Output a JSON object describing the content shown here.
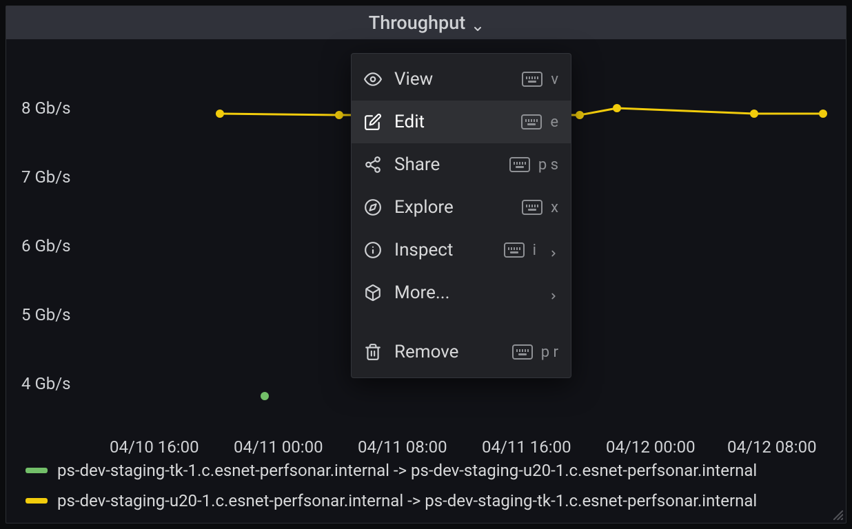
{
  "panel": {
    "title": "Throughput"
  },
  "menu": {
    "items": [
      {
        "label": "View",
        "shortcut": "v",
        "icon": "eye-icon",
        "has_sub": false
      },
      {
        "label": "Edit",
        "shortcut": "e",
        "icon": "edit-icon",
        "has_sub": false,
        "highlighted": true
      },
      {
        "label": "Share",
        "shortcut": "p s",
        "icon": "share-icon",
        "has_sub": false
      },
      {
        "label": "Explore",
        "shortcut": "x",
        "icon": "compass-icon",
        "has_sub": false
      },
      {
        "label": "Inspect",
        "shortcut": "i",
        "icon": "info-icon",
        "has_sub": true
      },
      {
        "label": "More...",
        "shortcut": "",
        "icon": "cube-icon",
        "has_sub": true
      }
    ],
    "remove": {
      "label": "Remove",
      "shortcut": "p r",
      "icon": "trash-icon"
    }
  },
  "legend": [
    {
      "color": "green",
      "label": "ps-dev-staging-tk-1.c.esnet-perfsonar.internal -> ps-dev-staging-u20-1.c.esnet-perfsonar.internal"
    },
    {
      "color": "yellow",
      "label": "ps-dev-staging-u20-1.c.esnet-perfsonar.internal -> ps-dev-staging-tk-1.c.esnet-perfsonar.internal"
    }
  ],
  "chart_data": {
    "type": "line",
    "title": "Throughput",
    "xlabel": "",
    "ylabel": "",
    "y_ticks": [
      "4 Gb/s",
      "5 Gb/s",
      "6 Gb/s",
      "7 Gb/s",
      "8 Gb/s"
    ],
    "ylim": [
      3.5,
      8.5
    ],
    "x_ticks": [
      "04/10 16:00",
      "04/11 00:00",
      "04/11 08:00",
      "04/11 16:00",
      "04/12 00:00",
      "04/12 08:00"
    ],
    "series": [
      {
        "name": "ps-dev-staging-tk-1.c.esnet-perfsonar.internal -> ps-dev-staging-u20-1.c.esnet-perfsonar.internal",
        "color": "#73bf69",
        "points": [
          {
            "x": "04/10 23:00",
            "y": 3.8
          }
        ]
      },
      {
        "name": "ps-dev-staging-u20-1.c.esnet-perfsonar.internal -> ps-dev-staging-tk-1.c.esnet-perfsonar.internal",
        "color": "#f2cc0c",
        "points": [
          {
            "x": "04/10 19:00",
            "y": 7.95
          },
          {
            "x": "04/11 04:00",
            "y": 7.95
          },
          {
            "x": "04/11 13:00",
            "y": 7.95
          },
          {
            "x": "04/11 20:00",
            "y": 8.05
          },
          {
            "x": "04/12 05:00",
            "y": 7.95
          },
          {
            "x": "04/12 12:00",
            "y": 7.95
          }
        ]
      }
    ]
  }
}
